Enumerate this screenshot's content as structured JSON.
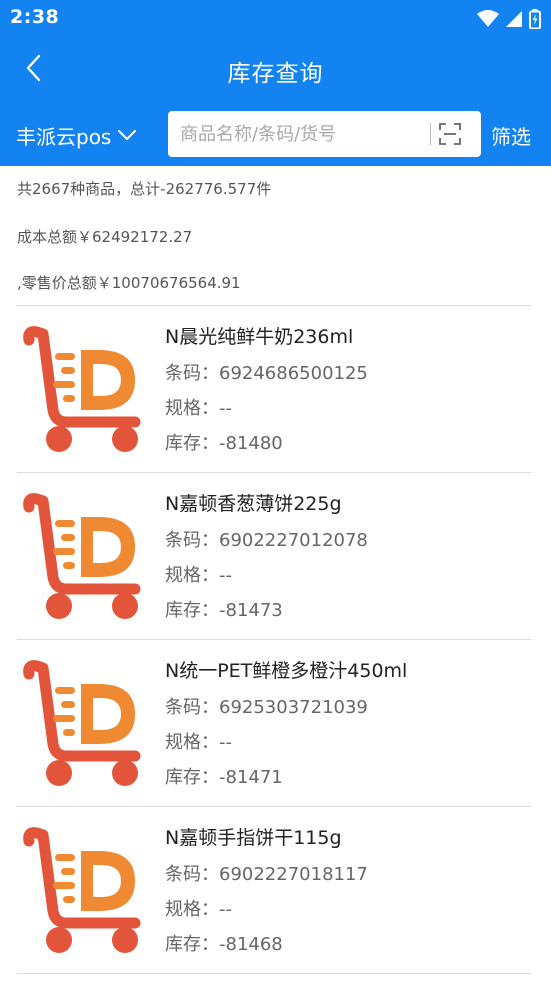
{
  "status_bar": {
    "time": "2:38"
  },
  "header": {
    "title": "库存查询"
  },
  "search": {
    "store_name": "丰派云pos",
    "placeholder": "商品名称/条码/货号",
    "filter_label": "筛选"
  },
  "summary": {
    "line1": "共2667种商品，总计-262776.577件",
    "line2": "成本总额￥62492172.27",
    "line3": ",零售价总额￥10070676564.91"
  },
  "products": [
    {
      "name": "N晨光纯鲜牛奶236ml",
      "barcode_label": "条码：",
      "barcode": "6924686500125",
      "spec_label": "规格：",
      "spec": "--",
      "stock_label": "库存：",
      "stock": "-81480"
    },
    {
      "name": "N嘉顿香葱薄饼225g",
      "barcode_label": "条码：",
      "barcode": "6902227012078",
      "spec_label": "规格：",
      "spec": "--",
      "stock_label": "库存：",
      "stock": "-81473"
    },
    {
      "name": "N统一PET鲜橙多橙汁450ml",
      "barcode_label": "条码：",
      "barcode": "6925303721039",
      "spec_label": "规格：",
      "spec": "--",
      "stock_label": "库存：",
      "stock": "-81471"
    },
    {
      "name": "N嘉顿手指饼干115g",
      "barcode_label": "条码：",
      "barcode": "6902227018117",
      "spec_label": "规格：",
      "spec": "--",
      "stock_label": "库存：",
      "stock": "-81468"
    }
  ],
  "icons": {
    "back": "chevron-left-icon",
    "dropdown": "chevron-down-icon",
    "scan": "scan-icon",
    "product_image": "shopping-cart-icon"
  },
  "colors": {
    "primary": "#1283f0",
    "cart_red": "#e2553a",
    "cart_orange": "#f08a32"
  }
}
